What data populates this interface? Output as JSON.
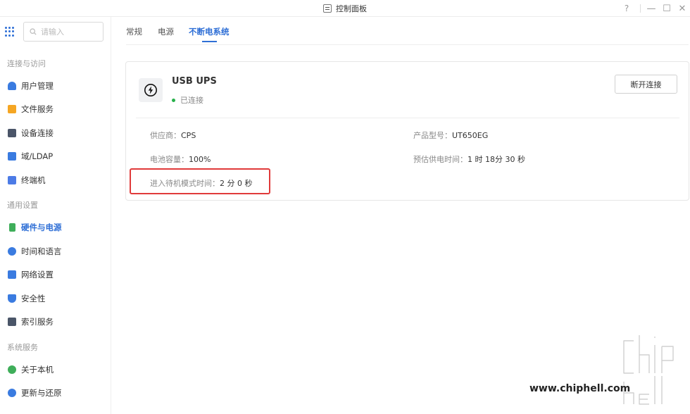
{
  "window": {
    "title": "控制面板",
    "help_label": "?",
    "minimize_label": "—",
    "maximize_label": "☐",
    "close_label": "✕"
  },
  "sidebar": {
    "search_placeholder": "请输入",
    "sections": [
      {
        "label": "连接与访问",
        "items": [
          {
            "label": "用户管理",
            "icon": "user-icon",
            "color": "#3a7be0"
          },
          {
            "label": "文件服务",
            "icon": "folder-icon",
            "color": "#f5a623"
          },
          {
            "label": "设备连接",
            "icon": "device-icon",
            "color": "#4a5568"
          },
          {
            "label": "域/LDAP",
            "icon": "domain-icon",
            "color": "#3a7be0"
          },
          {
            "label": "终端机",
            "icon": "terminal-icon",
            "color": "#4c7be6"
          }
        ]
      },
      {
        "label": "通用设置",
        "items": [
          {
            "label": "硬件与电源",
            "icon": "battery-icon",
            "color": "#3fae5a",
            "active": true
          },
          {
            "label": "时间和语言",
            "icon": "clock-icon",
            "color": "#3a7be0"
          },
          {
            "label": "网络设置",
            "icon": "network-icon",
            "color": "#3a7be0"
          },
          {
            "label": "安全性",
            "icon": "shield-icon",
            "color": "#3a7be0"
          },
          {
            "label": "索引服务",
            "icon": "index-icon",
            "color": "#4a5568"
          }
        ]
      },
      {
        "label": "系统服务",
        "items": [
          {
            "label": "关于本机",
            "icon": "info-icon",
            "color": "#3fae5a"
          },
          {
            "label": "更新与还原",
            "icon": "update-icon",
            "color": "#3a7be0"
          }
        ]
      }
    ]
  },
  "tabs": [
    {
      "label": "常规"
    },
    {
      "label": "电源"
    },
    {
      "label": "不断电系统",
      "active": true
    }
  ],
  "ups": {
    "name": "USB UPS",
    "status": "已连接",
    "status_color": "#27b04a",
    "disconnect_label": "断开连接",
    "vendor_label": "供应商：",
    "vendor_value": "CPS",
    "model_label": "产品型号：",
    "model_value": "UT650EG",
    "battery_label": "电池容量：",
    "battery_value": "100%",
    "runtime_label": "预估供电时间：",
    "runtime_value": "1 时 18分 30 秒",
    "standby_label": "进入待机模式时间：",
    "standby_value": "2 分 0 秒"
  },
  "watermark": {
    "url": "www.chiphell.com",
    "logo_text": "chiphell"
  },
  "colors": {
    "accent": "#2f6fd6",
    "highlight": "#e03a3a"
  }
}
